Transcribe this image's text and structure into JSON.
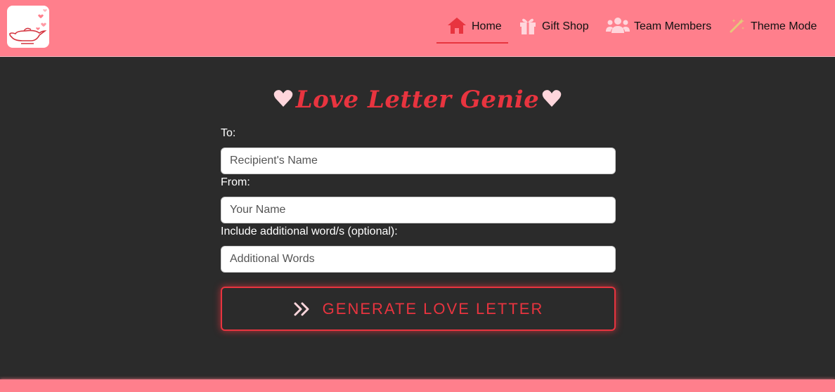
{
  "nav": {
    "items": [
      {
        "label": "Home",
        "icon": "home-icon"
      },
      {
        "label": "Gift Shop",
        "icon": "gift-icon"
      },
      {
        "label": "Team Members",
        "icon": "users-icon"
      },
      {
        "label": "Theme Mode",
        "icon": "wand-icon"
      }
    ]
  },
  "page": {
    "title": "Love Letter Genie"
  },
  "form": {
    "to_label": "To:",
    "to_placeholder": "Recipient's Name",
    "from_label": "From:",
    "from_placeholder": "Your Name",
    "extra_label": "Include additional word/s (optional):",
    "extra_placeholder": "Additional Words",
    "submit_label": "GENERATE LOVE LETTER"
  },
  "colors": {
    "brand_pink": "#ff7f8c",
    "accent_red": "#e8343f",
    "background": "#2b2b2b",
    "heart_pink": "#ffd6dc"
  }
}
